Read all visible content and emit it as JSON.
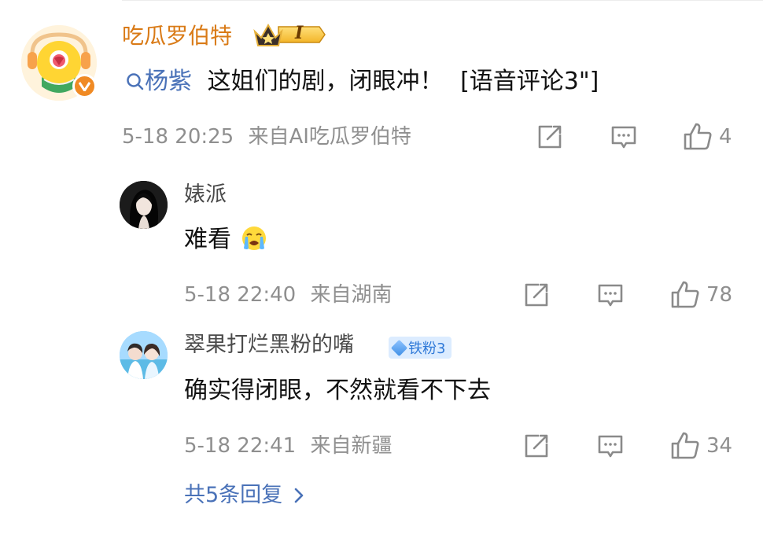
{
  "main_comment": {
    "username": "吃瓜罗伯特",
    "level_badge": "I",
    "topic": "杨紫",
    "text": "这姐们的剧，闭眼冲！",
    "voice_tag": "[语音评论3\"]",
    "time": "5-18 20:25",
    "source": "来自AI吃瓜罗伯特",
    "like_count": "4",
    "verified_icon": "verified-v-icon",
    "accent_color": "#d97a16",
    "link_color": "#4a72b8"
  },
  "replies": [
    {
      "username": "婊派",
      "text": "难看",
      "time": "5-18 22:40",
      "source": "来自湖南",
      "like_count": "78"
    },
    {
      "username": "翠果打烂黑粉的嘴",
      "fan_badge": "铁粉3",
      "text": "确实得闭眼，不然就看不下去",
      "time": "5-18 22:41",
      "source": "来自新疆",
      "like_count": "34"
    }
  ],
  "more_replies": {
    "label": "共5条回复",
    "icon": "chevron-right-icon"
  },
  "icons": {
    "repost": "repost-icon",
    "comment": "comment-icon",
    "like": "thumbs-up-icon"
  }
}
